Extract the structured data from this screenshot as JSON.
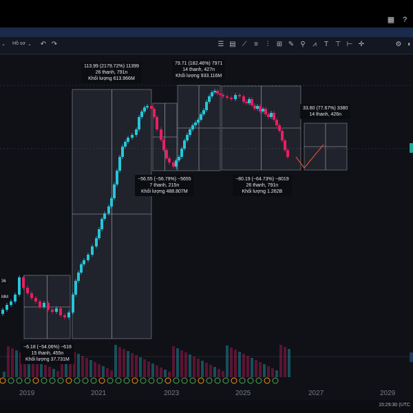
{
  "toolbar": {
    "ho_so_label": "Hồ sơ",
    "icons": [
      "chevron-down-icon",
      "undo-icon",
      "redo-icon",
      "filter-lines-icon",
      "channel-icon",
      "trend-line-icon",
      "fib-icon",
      "pitchfork-icon",
      "gann-icon",
      "brush-icon",
      "pin-icon",
      "pattern-icon",
      "text-icon",
      "ruler-icon",
      "measure-icon",
      "crosshair-icon",
      "magnet-icon",
      "settings-icon",
      "fullscreen-icon"
    ]
  },
  "window": {
    "icons": [
      "grid-icon",
      "help-icon"
    ]
  },
  "annotations": {
    "a1": {
      "line1": "113.99 (2179.72%) 11399",
      "line2": "26 thanh, 791n",
      "line3": "Khối lượng 613.966M"
    },
    "a2": {
      "line1": "79.71 (182.46%) 7971",
      "line2": "14 thanh, 427n",
      "line3": "Khối lượng 933.116M"
    },
    "a3": {
      "line1": "33.80 (77.67%) 3380",
      "line2": "14 thanh, 426n"
    },
    "a4": {
      "line1": "−56.55 (−56.79%) −5655",
      "line2": "7 thanh, 215n",
      "line3": "Khối lượng 488.807M"
    },
    "a5": {
      "line1": "−80.19 (−64.73%) −8019",
      "line2": "26 thanh, 791n",
      "line3": "Khối lượng 1.262B"
    },
    "a6": {
      "line1": "−6.18 (−54.06%) −618",
      "line2": "15 thanh, 455n",
      "line3": "Khối lượng 37.731M"
    },
    "left1": "36",
    "left2": "MM"
  },
  "years": [
    "2019",
    "2021",
    "2023",
    "2025",
    "2027",
    "2029"
  ],
  "status": {
    "time": "15:29:30 (UTC"
  },
  "colors": {
    "up": "#26c6da",
    "down": "#e91e63",
    "bg": "#0f1117",
    "box": "rgba(110,120,140,0.18)"
  }
}
